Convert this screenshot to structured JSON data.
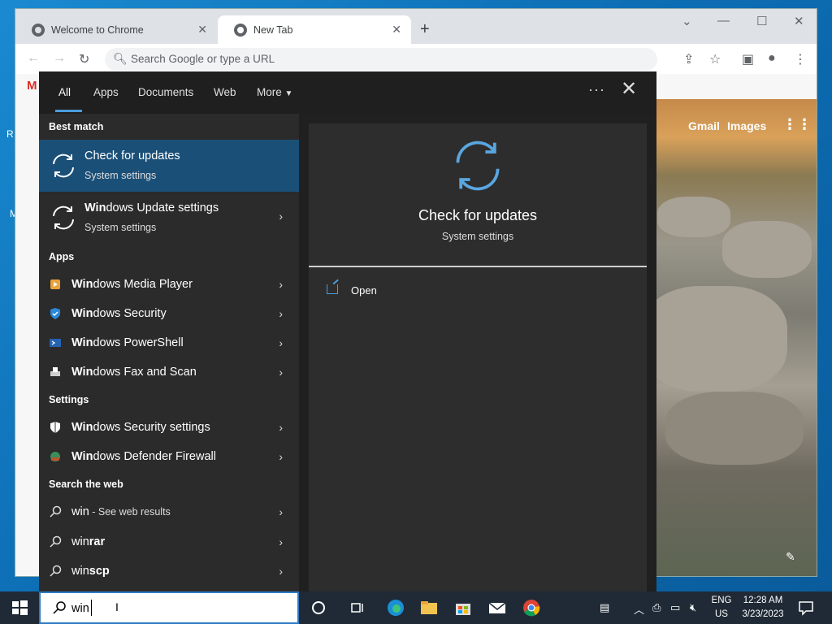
{
  "chrome": {
    "tabs": [
      {
        "label": "Welcome to Chrome",
        "close": "✕"
      },
      {
        "label": "New Tab",
        "close": "✕"
      }
    ],
    "new_tab": "+",
    "omnibox_placeholder": "Search Google or type a URL",
    "gmail": "Gmail",
    "images": "Images"
  },
  "search": {
    "filters": [
      "All",
      "Apps",
      "Documents",
      "Web",
      "More"
    ],
    "more_caret": "▼",
    "dots": "···",
    "close": "✕",
    "sections": {
      "best_match": "Best match",
      "apps": "Apps",
      "settings": "Settings",
      "web": "Search the web"
    },
    "best": {
      "bold": "",
      "title": "Check for updates",
      "subtitle": "System settings"
    },
    "second": {
      "bold": "Win",
      "title": "dows Update settings",
      "subtitle": "System settings"
    },
    "apps": [
      {
        "bold": "Win",
        "rest": "dows Media Player"
      },
      {
        "bold": "Win",
        "rest": "dows Security"
      },
      {
        "bold": "Win",
        "rest": "dows PowerShell"
      },
      {
        "bold": "Win",
        "rest": "dows Fax and Scan"
      }
    ],
    "settings": [
      {
        "bold": "Win",
        "rest": "dows Security settings"
      },
      {
        "bold": "Win",
        "rest": "dows Defender Firewall"
      }
    ],
    "web": [
      {
        "bold": "win",
        "rest": " - See web results",
        "small": true
      },
      {
        "bold": "win",
        "rest": "rar",
        "small": false
      },
      {
        "bold": "win",
        "rest": "scp",
        "small": false
      }
    ],
    "chevron": "›",
    "preview": {
      "title": "Check for updates",
      "subtitle": "System settings",
      "action": "Open"
    }
  },
  "taskbar": {
    "search_value": "win",
    "lang": "ENG",
    "region": "US",
    "time": "12:28 AM",
    "date": "3/23/2023"
  }
}
